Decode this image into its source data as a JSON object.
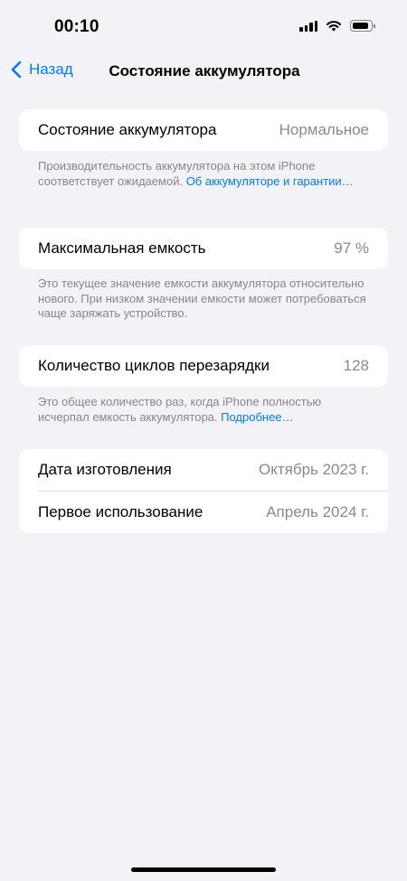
{
  "status_bar": {
    "time": "00:10"
  },
  "nav": {
    "back_label": "Назад",
    "title": "Состояние аккумулятора"
  },
  "health": {
    "label": "Состояние аккумулятора",
    "value": "Нормальное",
    "footer_text": "Производительность аккумулятора на этом iPhone соответствует ожидаемой. ",
    "footer_link": "Об аккумуляторе и гарантии…"
  },
  "capacity": {
    "label": "Максимальная емкость",
    "value": "97 %",
    "footer_text": "Это текущее значение емкости аккумулятора относительно нового. При низком значении емкости может потребоваться чаще заряжать устройство."
  },
  "cycles": {
    "label": "Количество циклов перезарядки",
    "value": "128",
    "footer_text": "Это общее количество раз, когда iPhone полностью исчерпал емкость аккумулятора. ",
    "footer_link": "Подробнее…"
  },
  "dates": {
    "manufacture_label": "Дата изготовления",
    "manufacture_value": "Октябрь 2023 г.",
    "first_use_label": "Первое использование",
    "first_use_value": "Апрель 2024 г."
  },
  "colors": {
    "accent": "#007aff",
    "background": "#f2f2f7",
    "secondary_text": "#8a8a8e"
  }
}
